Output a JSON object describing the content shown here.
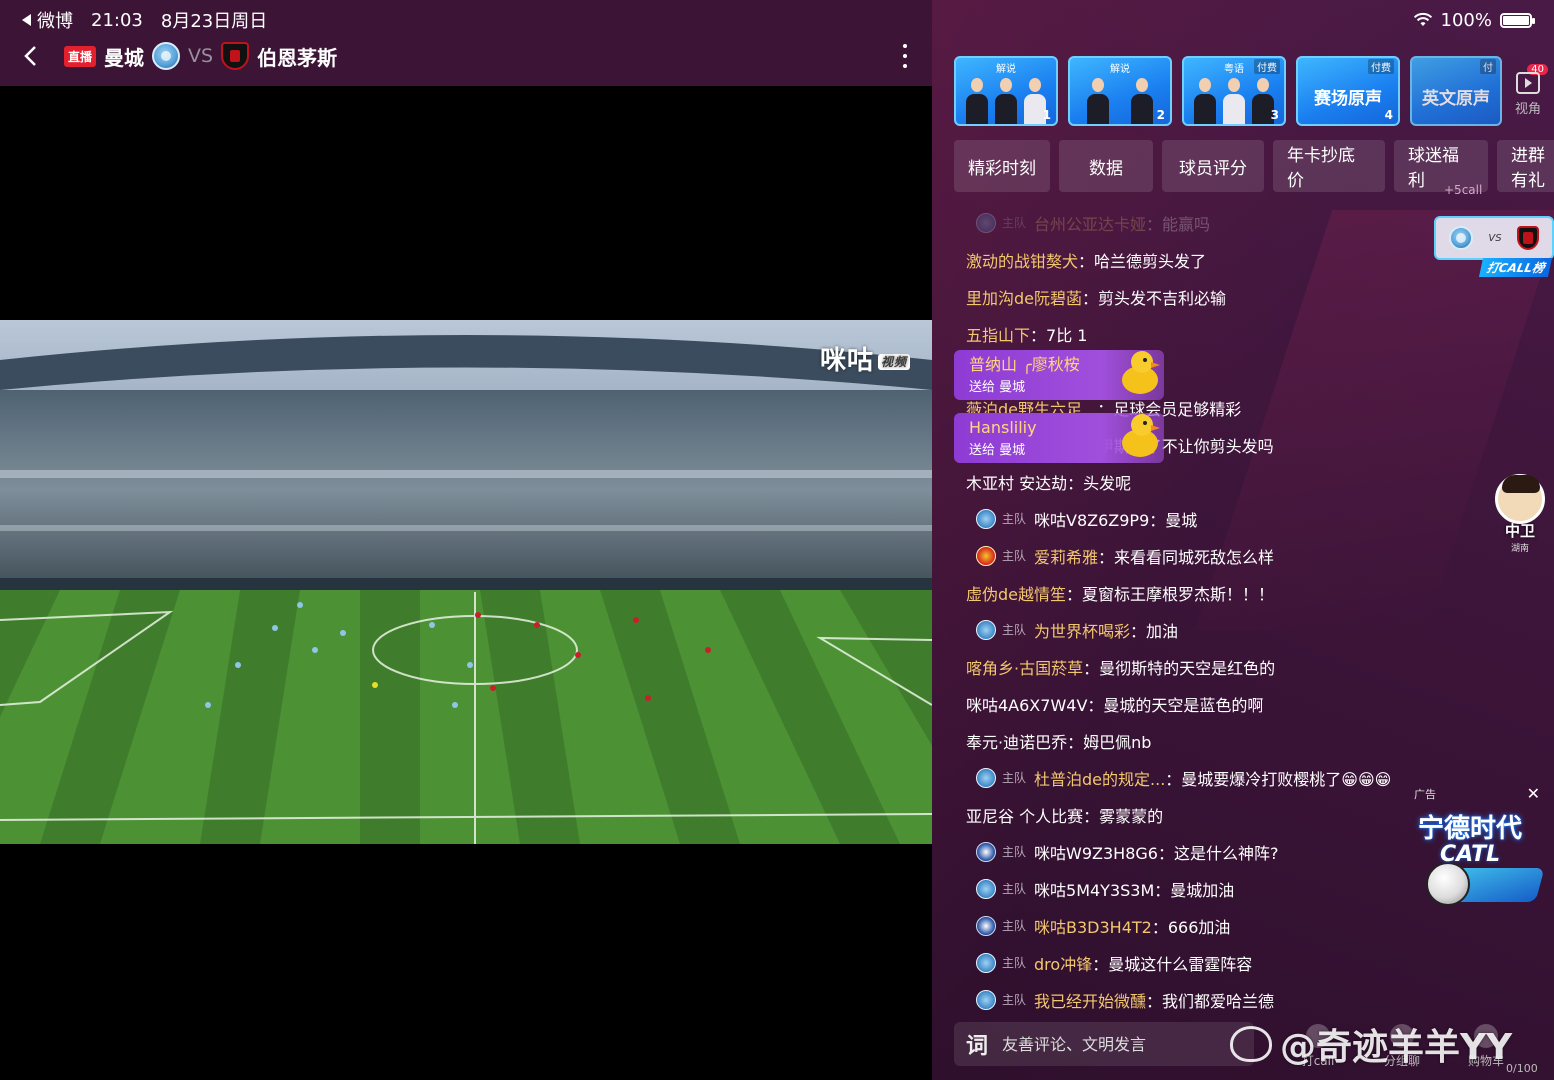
{
  "status_bar": {
    "back_app": "微博",
    "time": "21:03",
    "date": "8月23日周日",
    "battery": "100%",
    "battery_level": 1.0
  },
  "match": {
    "live_badge": "直播",
    "home_team": "曼城",
    "vs": "VS",
    "away_team": "伯恩茅斯"
  },
  "video": {
    "logo": "咪咕",
    "logo_tag": "视频"
  },
  "commentary": [
    {
      "tag": "解说",
      "number": "1",
      "pay": ""
    },
    {
      "tag": "解说",
      "number": "2",
      "pay": ""
    },
    {
      "tag": "粤语",
      "number": "3",
      "pay": "付费"
    },
    {
      "tag": "",
      "number": "4",
      "pay": "付费",
      "label": "赛场原声"
    },
    {
      "tag": "",
      "number": "",
      "pay": "付",
      "label": "英文原声"
    }
  ],
  "view_button": {
    "label": "视角",
    "badge": "40"
  },
  "func_tabs": [
    "精彩时刻",
    "数据",
    "球员评分",
    "年卡抄底价",
    "球迷福利",
    "进群有礼"
  ],
  "func_hint": "+5call",
  "chat": [
    {
      "team": "主队",
      "crest": "city",
      "user": "台州公亚达卡娅",
      "msg": "能赢吗",
      "faded": true
    },
    {
      "team": "",
      "crest": "",
      "user": "激动的战钳獒犬",
      "msg": "哈兰德剪头发了"
    },
    {
      "team": "",
      "crest": "",
      "user": "里加沟de阮碧菡",
      "msg": "剪头发不吉利必输"
    },
    {
      "team": "",
      "crest": "",
      "user": "五指山下",
      "msg": "7比 1"
    },
    {
      "team": "",
      "crest": "",
      "user": "普纳山",
      "msg": "哪",
      "hidden": true
    },
    {
      "team": "",
      "crest": "",
      "user": "薇泊de野生六足...",
      "msg": "足球会员足够精彩"
    },
    {
      "team": "",
      "crest": "",
      "user": "Hansliliy媒尊者",
      "msg": "伊斯说了不让你剪头发吗"
    },
    {
      "team": "",
      "crest": "",
      "user": "木亚村 安达劫",
      "msg": "头发呢",
      "plain": true
    },
    {
      "team": "主队",
      "crest": "city",
      "user": "咪咕V8Z6Z9P9",
      "msg": "曼城",
      "plain": true
    },
    {
      "team": "主队",
      "crest": "mu",
      "user": "爱莉希雅",
      "msg": "来看看同城死敌怎么样"
    },
    {
      "team": "",
      "crest": "",
      "user": "虚伪de越情笙",
      "msg": "夏窗标王摩根罗杰斯！！！"
    },
    {
      "team": "主队",
      "crest": "city",
      "user": "为世界杯喝彩",
      "msg": "加油"
    },
    {
      "team": "",
      "crest": "",
      "user": "喀角乡·古国菸草",
      "msg": "曼彻斯特的天空是红色的"
    },
    {
      "team": "",
      "crest": "",
      "user": "咪咕4A6X7W4V",
      "msg": "曼城的天空是蓝色的啊",
      "plain": true
    },
    {
      "team": "",
      "crest": "",
      "user": "奉元·迪诺巴乔",
      "msg": "姆巴佩nb",
      "plain": true
    },
    {
      "team": "主队",
      "crest": "city",
      "user": "杜普泊de的规定...",
      "msg": "曼城要爆冷打败樱桃了😁😁😁"
    },
    {
      "team": "",
      "crest": "",
      "user": "亚尼谷 个人比赛",
      "msg": "雾蒙蒙的",
      "plain": true
    },
    {
      "team": "主队",
      "crest": "che",
      "user": "咪咕W9Z3H8G6",
      "msg": "这是什么神阵?",
      "plain": true
    },
    {
      "team": "主队",
      "crest": "city",
      "user": "咪咕5M4Y3S3M",
      "msg": "曼城加油",
      "plain": true
    },
    {
      "team": "主队",
      "crest": "che",
      "user": "咪咕B3D3H4T2",
      "msg": "666加油"
    },
    {
      "team": "主队",
      "crest": "city",
      "user": "dro冲锋",
      "msg": "曼城这什么雷霆阵容"
    },
    {
      "team": "主队",
      "crest": "city",
      "user": "我已经开始微醺",
      "msg": "我们都爱哈兰德"
    }
  ],
  "gifts": [
    {
      "name": "普纳山 ╭廖秋桉",
      "to": "送给 曼城"
    },
    {
      "name": "Hansliliy",
      "to": "送给 曼城"
    }
  ],
  "callboard": {
    "vs": "VS",
    "label": "打CALL榜"
  },
  "mascot": {
    "label": "中卫",
    "sub": "湖南"
  },
  "ad": {
    "tag": "广告",
    "close": "✕",
    "title": "宁德时代",
    "brand": "CATL"
  },
  "input": {
    "icon": "词",
    "placeholder": "友善评论、文明发言"
  },
  "bottom_actions": [
    "打call",
    "分组聊",
    "购物车"
  ],
  "counter": "0/100",
  "watermark": "@奇迹羊羊YY",
  "colors": {
    "accent": "#f2c76d",
    "live": "#e4202f",
    "tab_blue": "#1a7ff0",
    "gift_purple": "#a04fdc"
  }
}
